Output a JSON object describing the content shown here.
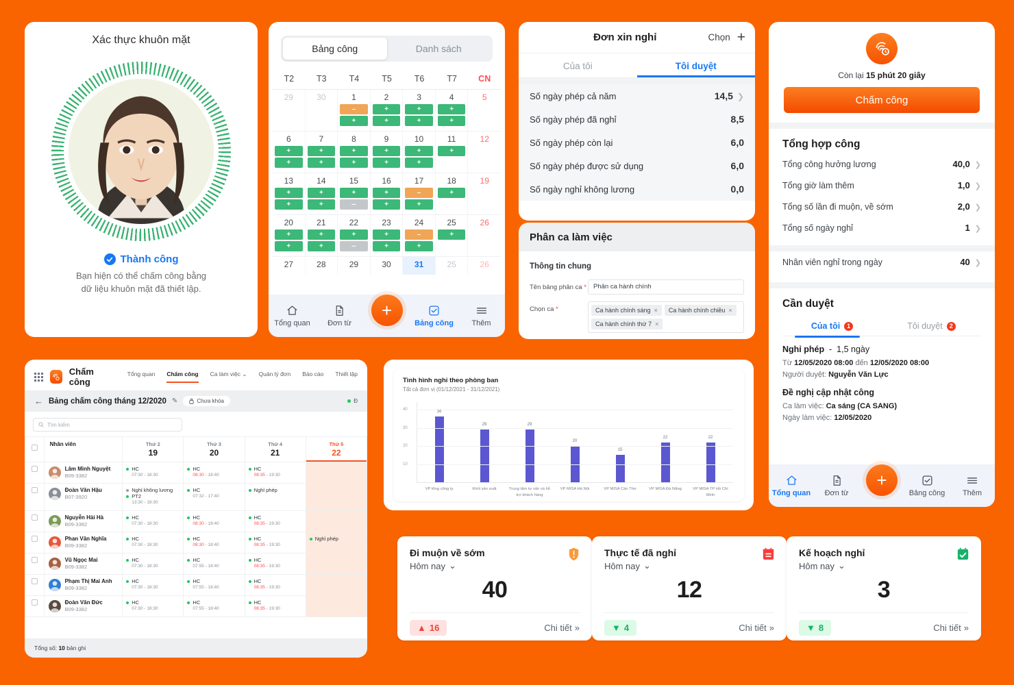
{
  "brand_color": "#fa6400",
  "face_auth": {
    "title": "Xác thực khuôn mặt",
    "status": "Thành công",
    "desc_line1": "Bạn hiện có thể chấm công bằng",
    "desc_line2": "dữ liệu khuôn mặt đã thiết lập."
  },
  "calendar": {
    "segments": [
      {
        "label": "Bảng công",
        "active": true
      },
      {
        "label": "Danh sách",
        "active": false
      }
    ],
    "dow": [
      "T2",
      "T3",
      "T4",
      "T5",
      "T6",
      "T7",
      "CN"
    ],
    "weeks": [
      [
        {
          "day": "29",
          "mute": true,
          "chips": []
        },
        {
          "day": "30",
          "mute": true,
          "chips": []
        },
        {
          "day": "1",
          "chips": [
            "o",
            "g"
          ]
        },
        {
          "day": "2",
          "chips": [
            "g",
            "g"
          ]
        },
        {
          "day": "3",
          "chips": [
            "g",
            "g"
          ]
        },
        {
          "day": "4",
          "chips": [
            "g",
            "g"
          ]
        },
        {
          "day": "5",
          "sun": true,
          "chips": []
        }
      ],
      [
        {
          "day": "6",
          "chips": [
            "g",
            "g"
          ]
        },
        {
          "day": "7",
          "chips": [
            "g",
            "g"
          ]
        },
        {
          "day": "8",
          "chips": [
            "g",
            "g"
          ]
        },
        {
          "day": "9",
          "chips": [
            "g",
            "g"
          ]
        },
        {
          "day": "10",
          "chips": [
            "g",
            "g"
          ]
        },
        {
          "day": "11",
          "chips": [
            "g"
          ]
        },
        {
          "day": "12",
          "sun": true,
          "chips": []
        }
      ],
      [
        {
          "day": "13",
          "chips": [
            "g",
            "g"
          ]
        },
        {
          "day": "14",
          "chips": [
            "g",
            "g"
          ]
        },
        {
          "day": "15",
          "chips": [
            "g",
            "x"
          ]
        },
        {
          "day": "16",
          "chips": [
            "g",
            "g"
          ]
        },
        {
          "day": "17",
          "chips": [
            "o",
            "g"
          ]
        },
        {
          "day": "18",
          "chips": [
            "g"
          ]
        },
        {
          "day": "19",
          "sun": true,
          "chips": []
        }
      ],
      [
        {
          "day": "20",
          "chips": [
            "g",
            "g"
          ]
        },
        {
          "day": "21",
          "chips": [
            "g",
            "g"
          ]
        },
        {
          "day": "22",
          "chips": [
            "g",
            "x"
          ]
        },
        {
          "day": "23",
          "chips": [
            "g",
            "g"
          ]
        },
        {
          "day": "24",
          "chips": [
            "o",
            "g"
          ]
        },
        {
          "day": "25",
          "chips": [
            "g"
          ]
        },
        {
          "day": "26",
          "sun": true,
          "chips": []
        }
      ],
      [
        {
          "day": "27",
          "chips": []
        },
        {
          "day": "28",
          "chips": []
        },
        {
          "day": "29",
          "chips": []
        },
        {
          "day": "30",
          "chips": []
        },
        {
          "day": "31",
          "selected": true,
          "chips": []
        },
        {
          "day": "25",
          "mute": true,
          "chips": []
        },
        {
          "day": "26",
          "summute": true,
          "chips": []
        }
      ]
    ],
    "chip_plus": "+",
    "chip_minus": "–",
    "chip_dash": "--",
    "tabbar": [
      {
        "label": "Tổng quan",
        "icon": "home-icon",
        "active": false
      },
      {
        "label": "Đơn từ",
        "icon": "document-icon",
        "active": false
      },
      {
        "label": "",
        "icon": "plus-fab",
        "active": false
      },
      {
        "label": "Bảng công",
        "icon": "checkbox-icon",
        "active": true
      },
      {
        "label": "Thêm",
        "icon": "menu-icon",
        "active": false
      }
    ]
  },
  "leave": {
    "header": {
      "title": "Đơn xin nghỉ",
      "choose": "Chọn",
      "add": "+"
    },
    "tabs": [
      {
        "label": "Của tôi",
        "active": false
      },
      {
        "label": "Tôi duyệt",
        "active": true
      }
    ],
    "rows": [
      {
        "label": "Số ngày phép cả năm",
        "value": "14,5",
        "arrow": true
      },
      {
        "label": "Số ngày phép đã nghỉ",
        "value": "8,5",
        "arrow": false
      },
      {
        "label": "Số ngày phép còn lại",
        "value": "6,0",
        "arrow": false
      },
      {
        "label": "Số ngày phép được sử dụng",
        "value": "6,0",
        "arrow": false
      },
      {
        "label": "Số ngày nghỉ không lương",
        "value": "0,0",
        "arrow": false
      }
    ]
  },
  "shift": {
    "title": "Phân ca làm việc",
    "subtitle": "Thông tin chung",
    "name_label": "Tên bảng phân ca",
    "name_value": "Phân ca hành chính",
    "choose_label": "Chọn ca",
    "tags": [
      "Ca hành chính sáng",
      "Ca hành chính chiều",
      "Ca hành chính thứ 7"
    ],
    "tag_close": "×",
    "required": "*"
  },
  "overview": {
    "remaining_prefix": "Còn lại ",
    "remaining_value": "15 phút 20 giây",
    "checkin_button": "Chấm công",
    "summary_title": "Tổng hợp công",
    "summary_rows": [
      {
        "label": "Tổng công hưởng lương",
        "value": "40,0"
      },
      {
        "label": "Tổng giờ làm thêm",
        "value": "1,0"
      },
      {
        "label": "Tổng số lần đi muộn, về sớm",
        "value": "2,0"
      },
      {
        "label": "Tổng số ngày nghỉ",
        "value": "1"
      }
    ],
    "absent_row": {
      "label": "Nhân viên nghỉ trong ngày",
      "value": "40"
    },
    "approve_title": "Cần duyệt",
    "approve_tabs": [
      {
        "label": "Của tôi",
        "badge": "1",
        "active": true
      },
      {
        "label": "Tôi duyệt",
        "badge": "2",
        "active": false
      }
    ],
    "items": [
      {
        "title": "Nghỉ phép",
        "title_sep": "-",
        "title_extra": "1,5 ngày",
        "lines": [
          {
            "pre": "Từ ",
            "b1": "12/05/2020 08:00",
            "mid": " đến ",
            "b2": "12/05/2020 08:00"
          },
          {
            "pre": "Người duyệt: ",
            "b1": "Nguyễn Văn Lực"
          }
        ]
      },
      {
        "title": "Đề nghị cập nhật công",
        "lines": [
          {
            "pre": "Ca làm việc: ",
            "b1": "Ca sáng (CA SANG)"
          },
          {
            "pre": "Ngày làm việc: ",
            "b1": "12/05/2020"
          }
        ]
      }
    ],
    "tabbar": [
      {
        "label": "Tổng quan",
        "icon": "home-icon",
        "active": true
      },
      {
        "label": "Đơn từ",
        "icon": "document-icon",
        "active": false
      },
      {
        "label": "",
        "icon": "plus-fab",
        "active": false
      },
      {
        "label": "Bảng công",
        "icon": "checkbox-icon",
        "active": false
      },
      {
        "label": "Thêm",
        "icon": "menu-icon",
        "active": false
      }
    ]
  },
  "desktop": {
    "app_name": "Chấm công",
    "nav": [
      {
        "label": "Tổng quan",
        "active": false,
        "caret": false
      },
      {
        "label": "Chấm công",
        "active": true,
        "caret": false
      },
      {
        "label": "Ca làm việc",
        "active": false,
        "caret": true
      },
      {
        "label": "Quản lý đơn",
        "active": false,
        "caret": false
      },
      {
        "label": "Báo cáo",
        "active": false,
        "caret": false
      },
      {
        "label": "Thiết lập",
        "active": false,
        "caret": false
      }
    ],
    "page_title": "Bảng chấm công tháng 12/2020",
    "lock_chip": "Chưa khóa",
    "status_edge": "Đ",
    "search_placeholder": "Tìm kiếm",
    "col_employee": "Nhân viên",
    "columns": [
      {
        "dow": "Thứ 2",
        "num": "19",
        "highlight": false
      },
      {
        "dow": "Thứ 3",
        "num": "20",
        "highlight": false
      },
      {
        "dow": "Thứ 4",
        "num": "21",
        "highlight": false
      },
      {
        "dow": "Thứ 5",
        "num": "22",
        "highlight": true
      }
    ],
    "rows": [
      {
        "name": "Lâm Minh Nguyệt",
        "code": "B09-3382",
        "avatar": "#c98b6b",
        "cells": [
          {
            "entries": [
              {
                "dot": "green",
                "label": "HC",
                "time_a": "07:30",
                "time_b": "18:30",
                "late": false
              }
            ]
          },
          {
            "entries": [
              {
                "dot": "green",
                "label": "HC",
                "time_a": "08:30",
                "time_b": "18:40",
                "late": true
              }
            ]
          },
          {
            "entries": [
              {
                "dot": "green",
                "label": "HC",
                "time_a": "08:35",
                "time_b": "19:30",
                "late": true
              }
            ]
          },
          {
            "entries": []
          }
        ]
      },
      {
        "name": "Đoàn Văn Hậu",
        "code": "B07-3920",
        "avatar": "#8a8f97",
        "cells": [
          {
            "entries": [
              {
                "dot": "gray",
                "label": "Nghỉ không lương"
              },
              {
                "dot": "green",
                "label": "PT2",
                "time_a": "13:30",
                "time_b": "18:30",
                "late": false
              }
            ]
          },
          {
            "entries": [
              {
                "dot": "green",
                "label": "HC",
                "time_a": "07:32",
                "time_b": "17:40",
                "late": false
              }
            ]
          },
          {
            "entries": [
              {
                "dot": "green",
                "label": "Nghỉ phép"
              }
            ]
          },
          {
            "entries": []
          }
        ]
      },
      {
        "name": "Nguyễn Hải Hà",
        "code": "B09-3382",
        "avatar": "#7c9a56",
        "cells": [
          {
            "entries": [
              {
                "dot": "green",
                "label": "HC",
                "time_a": "07:30",
                "time_b": "18:30",
                "late": false
              }
            ]
          },
          {
            "entries": [
              {
                "dot": "green",
                "label": "HC",
                "time_a": "08:30",
                "time_b": "18:40",
                "late": true
              }
            ]
          },
          {
            "entries": [
              {
                "dot": "green",
                "label": "HC",
                "time_a": "08:35",
                "time_b": "19:30",
                "late": true
              }
            ]
          },
          {
            "entries": []
          }
        ]
      },
      {
        "name": "Phan Văn Nghĩa",
        "code": "B09-3382",
        "avatar": "#e8563b",
        "cells": [
          {
            "entries": [
              {
                "dot": "green",
                "label": "HC",
                "time_a": "07:30",
                "time_b": "18:30",
                "late": false
              }
            ]
          },
          {
            "entries": [
              {
                "dot": "green",
                "label": "HC",
                "time_a": "08:30",
                "time_b": "18:40",
                "late": true
              }
            ]
          },
          {
            "entries": [
              {
                "dot": "green",
                "label": "HC",
                "time_a": "08:35",
                "time_b": "19:30",
                "late": true
              }
            ]
          },
          {
            "entries": [
              {
                "dot": "green",
                "label": "Nghỉ phép"
              }
            ]
          }
        ]
      },
      {
        "name": "Vũ Ngọc Mai",
        "code": "B09-3382",
        "avatar": "#a8603f",
        "cells": [
          {
            "entries": [
              {
                "dot": "green",
                "label": "HC",
                "time_a": "07:30",
                "time_b": "18:30",
                "late": false
              }
            ]
          },
          {
            "entries": [
              {
                "dot": "green",
                "label": "HC",
                "time_a": "07:55",
                "time_b": "18:40",
                "late": false
              }
            ]
          },
          {
            "entries": [
              {
                "dot": "green",
                "label": "HC",
                "time_a": "08:35",
                "time_b": "19:30",
                "late": true
              }
            ]
          },
          {
            "entries": []
          }
        ]
      },
      {
        "name": "Phạm Thị Mai Anh",
        "code": "B09-3382",
        "avatar": "#2f7fd4",
        "cells": [
          {
            "entries": [
              {
                "dot": "green",
                "label": "HC",
                "time_a": "07:30",
                "time_b": "18:30",
                "late": false
              }
            ]
          },
          {
            "entries": [
              {
                "dot": "green",
                "label": "HC",
                "time_a": "07:55",
                "time_b": "18:40",
                "late": false
              }
            ]
          },
          {
            "entries": [
              {
                "dot": "green",
                "label": "HC",
                "time_a": "08:35",
                "time_b": "19:30",
                "late": true
              }
            ]
          },
          {
            "entries": []
          }
        ]
      },
      {
        "name": "Đoàn Văn Đức",
        "code": "B09-3382",
        "avatar": "#5b4a3f",
        "cells": [
          {
            "entries": [
              {
                "dot": "green",
                "label": "HC",
                "time_a": "07:30",
                "time_b": "18:30",
                "late": false
              }
            ]
          },
          {
            "entries": [
              {
                "dot": "green",
                "label": "HC",
                "time_a": "07:55",
                "time_b": "18:40",
                "late": false
              }
            ]
          },
          {
            "entries": [
              {
                "dot": "green",
                "label": "HC",
                "time_a": "08:35",
                "time_b": "19:30",
                "late": true
              }
            ]
          },
          {
            "entries": []
          }
        ]
      }
    ],
    "footer_pre": "Tổng số: ",
    "footer_count": "10",
    "footer_post": " bản ghi"
  },
  "chart_data": {
    "type": "bar",
    "title": "Tình hình nghỉ theo phòng ban",
    "subtitle": "Tất cả đơn vị (01/12/2021 - 31/12/2021)",
    "categories": [
      "VP tổng công ty",
      "Khối sản xuất",
      "Trung tâm tư vấn và hỗ trợ khách hàng",
      "VP MISA Hà Nội",
      "VP MISA Cần Thơ",
      "VP MISA Đà Nẵng",
      "VP MISA TP Hồ Chí Minh"
    ],
    "values": [
      36,
      29,
      29,
      20,
      15,
      22,
      22
    ],
    "bar_color": "#5b57d1",
    "xlabel": "",
    "ylabel": "",
    "ylim": [
      0,
      44
    ],
    "yticks": [
      10,
      20,
      30,
      40
    ],
    "grid": true,
    "legend": "none"
  },
  "stats": [
    {
      "title": "Đi muộn về sớm",
      "period": "Hôm nay",
      "value": "40",
      "delta": "16",
      "delta_dir": "up",
      "detail": "Chi tiết",
      "icon": "alert-shield-icon",
      "icon_color": "#fa9a3c"
    },
    {
      "title": "Thực tế đã nghỉ",
      "period": "Hôm nay",
      "value": "12",
      "delta": "4",
      "delta_dir": "down",
      "detail": "Chi tiết",
      "icon": "calendar-minus-icon",
      "icon_color": "#fa3c3c"
    },
    {
      "title": "Kế hoạch nghỉ",
      "period": "Hôm nay",
      "value": "3",
      "delta": "8",
      "delta_dir": "down",
      "detail": "Chi tiết",
      "icon": "calendar-check-icon",
      "icon_color": "#17b26a"
    }
  ]
}
